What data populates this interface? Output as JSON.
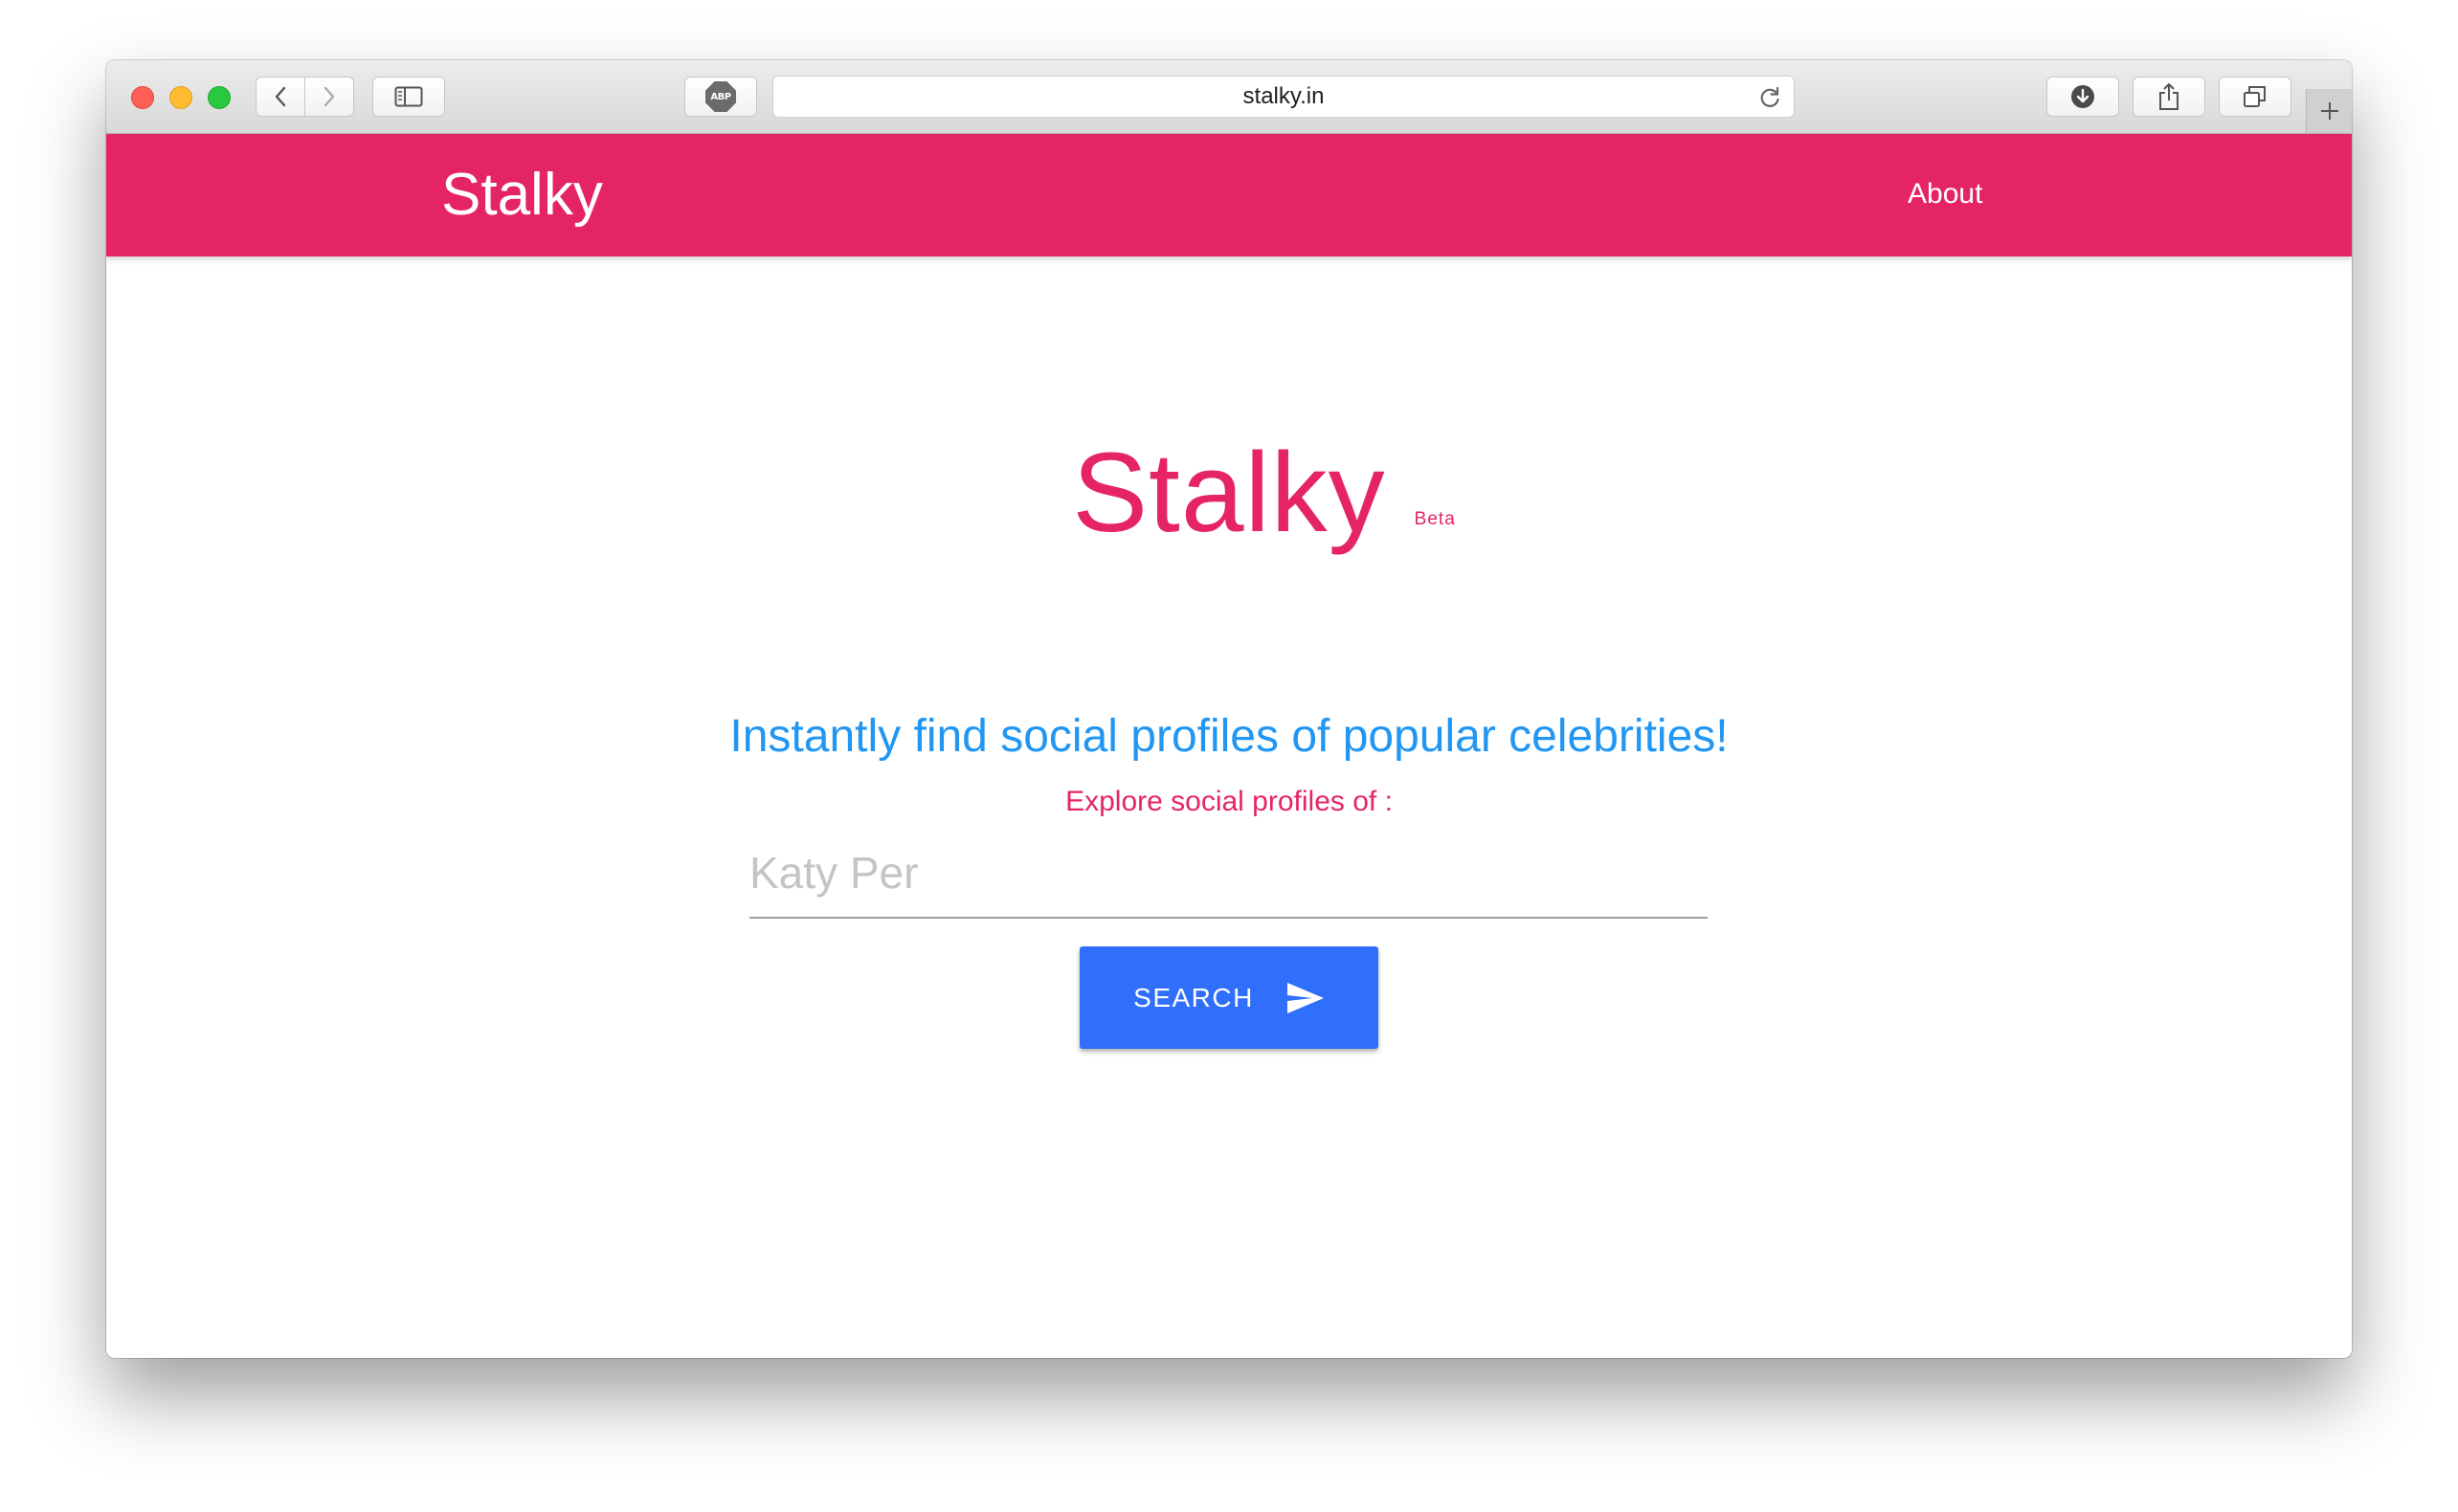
{
  "browser": {
    "url": "stalky.in",
    "adblock_label": "ABP"
  },
  "navbar": {
    "brand": "Stalky",
    "about_link": "About",
    "color": "#e52563"
  },
  "hero": {
    "title": "Stalky",
    "badge": "Beta",
    "tagline": "Instantly find social profiles of popular celebrities!",
    "subtitle": "Explore social profiles of :"
  },
  "search": {
    "placeholder": "Katy Per",
    "value": "",
    "button_label": "SEARCH",
    "button_icon": "send-icon",
    "button_color": "#2f6ffb"
  },
  "icons": [
    "chevron-left-icon",
    "chevron-right-icon",
    "sidebar-icon",
    "adblock-icon",
    "reload-icon",
    "download-icon",
    "share-icon",
    "tabs-icon",
    "plus-icon",
    "send-icon"
  ]
}
